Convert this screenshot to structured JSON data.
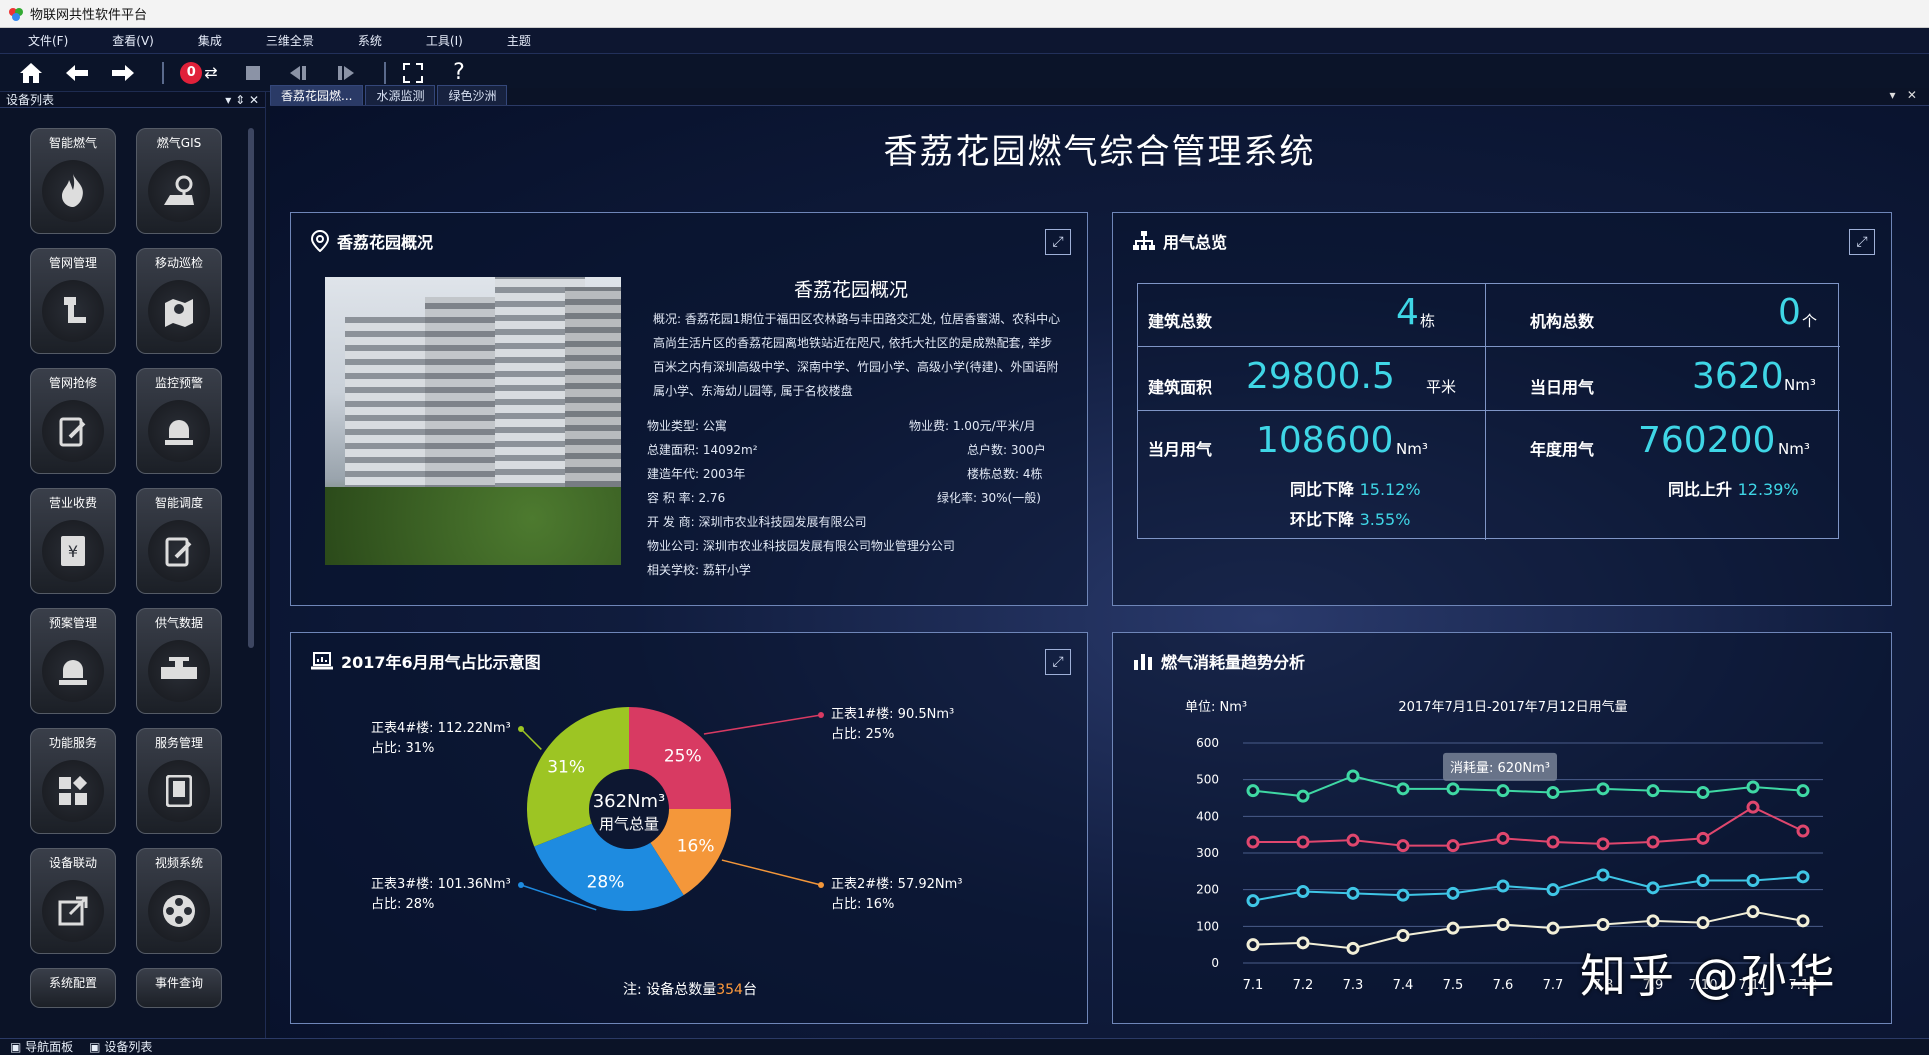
{
  "window": {
    "title": "物联网共性软件平台"
  },
  "menu": [
    "文件(F)",
    "查看(V)",
    "集成",
    "三维全景",
    "系统",
    "工具(I)",
    "主题"
  ],
  "toolbar": {
    "badge": "0"
  },
  "sidebar": {
    "title": "设备列表",
    "modules": [
      "智能燃气",
      "燃气GIS",
      "管网管理",
      "移动巡检",
      "管网抢修",
      "监控预警",
      "营业收费",
      "智能调度",
      "预案管理",
      "供气数据",
      "功能服务",
      "服务管理",
      "设备联动",
      "视频系统",
      "系统配置",
      "事件查询"
    ]
  },
  "tabs": [
    "香荔花园燃...",
    "水源监测",
    "绿色沙洲"
  ],
  "page": {
    "title": "香荔花园燃气综合管理系统"
  },
  "overview": {
    "panel_title": "香荔花园概况",
    "heading": "香荔花园概况",
    "desc": "概况: 香荔花园1期位于福田区农林路与丰田路交汇处, 位居香蜜湖、农科中心高尚生活片区的香荔花园离地铁站近在咫尺, 依托大社区的是成熟配套, 举步百米之内有深圳高级中学、深南中学、竹园小学、高级小学(待建)、外国语附属小学、东海幼儿园等, 属于名校楼盘",
    "kv": {
      "type": "物业类型: 公寓",
      "fee": "物业费: 1.00元/平米/月",
      "area": "总建面积: 14092m²",
      "households": "总户数: 300户",
      "year": "建造年代: 2003年",
      "buildings": "楼栋总数: 4栋",
      "far": "容 积 率: 2.76",
      "green": "绿化率: 30%(一般)",
      "developer": "开 发 商: 深圳市农业科技园发展有限公司",
      "pm": "物业公司: 深圳市农业科技园发展有限公司物业管理分公司",
      "school": "相关学校: 荔轩小学"
    }
  },
  "usage": {
    "panel_title": "用气总览",
    "buildings_label": "建筑总数",
    "buildings_value": "4",
    "buildings_unit": "栋",
    "orgs_label": "机构总数",
    "orgs_value": "0",
    "orgs_unit": "个",
    "area_label": "建筑面积",
    "area_value": "29800.5",
    "area_unit": "平米",
    "day_label": "当日用气",
    "day_value": "3620",
    "day_unit": "Nm³",
    "month_label": "当月用气",
    "month_value": "108600",
    "month_unit": "Nm³",
    "year_label": "年度用气",
    "year_value": "760200",
    "year_unit": "Nm³",
    "month_yoy_label": "同比下降",
    "month_yoy": "15.12%",
    "month_mom_label": "环比下降",
    "month_mom": "3.55%",
    "year_yoy_label": "同比上升",
    "year_yoy": "12.39%"
  },
  "pie": {
    "panel_title": "2017年6月用气占比示意图",
    "center_value": "362Nm³",
    "center_label": "用气总量",
    "note_prefix": "注: 设备总数量",
    "note_value": "354",
    "note_suffix": "台"
  },
  "trend": {
    "panel_title": "燃气消耗量趋势分析",
    "unit_label": "单位: Nm³",
    "chart_title": "2017年7月1日-2017年7月12日用气量",
    "tooltip": "消耗量: 620Nm³"
  },
  "chart_data": [
    {
      "type": "pie",
      "title": "2017年6月用气占比示意图",
      "slices": [
        {
          "name": "正表1#楼",
          "value": 90.5,
          "unit": "Nm³",
          "percent": 25,
          "label": "正表1#楼: 90.5Nm³",
          "sub": "占比: 25%",
          "color": "#d83a62"
        },
        {
          "name": "正表2#楼",
          "value": 57.92,
          "unit": "Nm³",
          "percent": 16,
          "label": "正表2#楼: 57.92Nm³",
          "sub": "占比: 16%",
          "color": "#f4973a"
        },
        {
          "name": "正表3#楼",
          "value": 101.36,
          "unit": "Nm³",
          "percent": 28,
          "label": "正表3#楼: 101.36Nm³",
          "sub": "占比: 28%",
          "color": "#1e8be0"
        },
        {
          "name": "正表4#楼",
          "value": 112.22,
          "unit": "Nm³",
          "percent": 31,
          "label": "正表4#楼: 112.22Nm³",
          "sub": "占比: 31%",
          "color": "#9dc523"
        }
      ]
    },
    {
      "type": "line",
      "title": "2017年7月1日-2017年7月12日用气量",
      "ylabel": "单位: Nm³",
      "ylim": [
        0,
        600
      ],
      "yticks": [
        0,
        100,
        200,
        300,
        400,
        500,
        600
      ],
      "categories": [
        "7.1",
        "7.2",
        "7.3",
        "7.4",
        "7.5",
        "7.6",
        "7.7",
        "7.8",
        "7.9",
        "7.10",
        "7.11",
        "7.12"
      ],
      "grid": true,
      "series": [
        {
          "color": "#3fd8a4",
          "values": [
            470,
            455,
            510,
            475,
            475,
            470,
            465,
            475,
            470,
            465,
            480,
            470
          ]
        },
        {
          "color": "#e0476e",
          "values": [
            330,
            330,
            335,
            320,
            320,
            340,
            330,
            325,
            330,
            340,
            425,
            360
          ]
        },
        {
          "color": "#3fc6e6",
          "values": [
            170,
            195,
            190,
            185,
            190,
            210,
            200,
            240,
            205,
            225,
            225,
            235
          ]
        },
        {
          "color": "#f2efd8",
          "values": [
            50,
            55,
            40,
            75,
            95,
            105,
            95,
            105,
            115,
            110,
            140,
            115
          ]
        }
      ]
    }
  ],
  "watermark": "知乎 @孙华",
  "bottom": [
    "导航面板",
    "设备列表"
  ]
}
